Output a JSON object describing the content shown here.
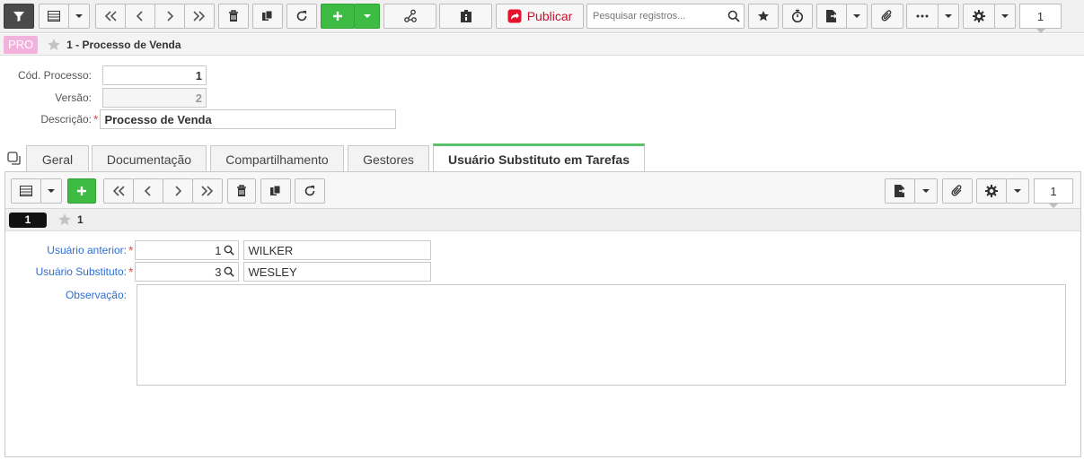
{
  "toolbar": {
    "publish_label": "Publicar",
    "search_placeholder": "Pesquisar registros...",
    "page_number": "1"
  },
  "breadcrumb": {
    "badge": "PRO",
    "title": "1 - Processo de Venda"
  },
  "form": {
    "codigo_label": "Cód. Processo:",
    "codigo_value": "1",
    "versao_label": "Versão:",
    "versao_value": "2",
    "descricao_label": "Descrição:",
    "descricao_value": "Processo de Venda"
  },
  "tabs": [
    {
      "label": "Geral"
    },
    {
      "label": "Documentação"
    },
    {
      "label": "Compartilhamento"
    },
    {
      "label": "Gestores"
    },
    {
      "label": "Usuário Substituto em Tarefas"
    }
  ],
  "detail": {
    "page_number": "1",
    "record_badge": "1",
    "record_title": "1",
    "usuario_anterior_label": "Usuário anterior:",
    "usuario_anterior_code": "1",
    "usuario_anterior_name": "WILKER",
    "usuario_substituto_label": "Usuário Substituto:",
    "usuario_substituto_code": "3",
    "usuario_substituto_name": "WESLEY",
    "observacao_label": "Observação:",
    "observacao_value": ""
  },
  "colors": {
    "accent_green": "#3dbb43",
    "active_tab": "#5cc269",
    "publish_red": "#c8102e",
    "label_blue": "#2d6fd1",
    "badge_pink": "#f3b1de"
  }
}
